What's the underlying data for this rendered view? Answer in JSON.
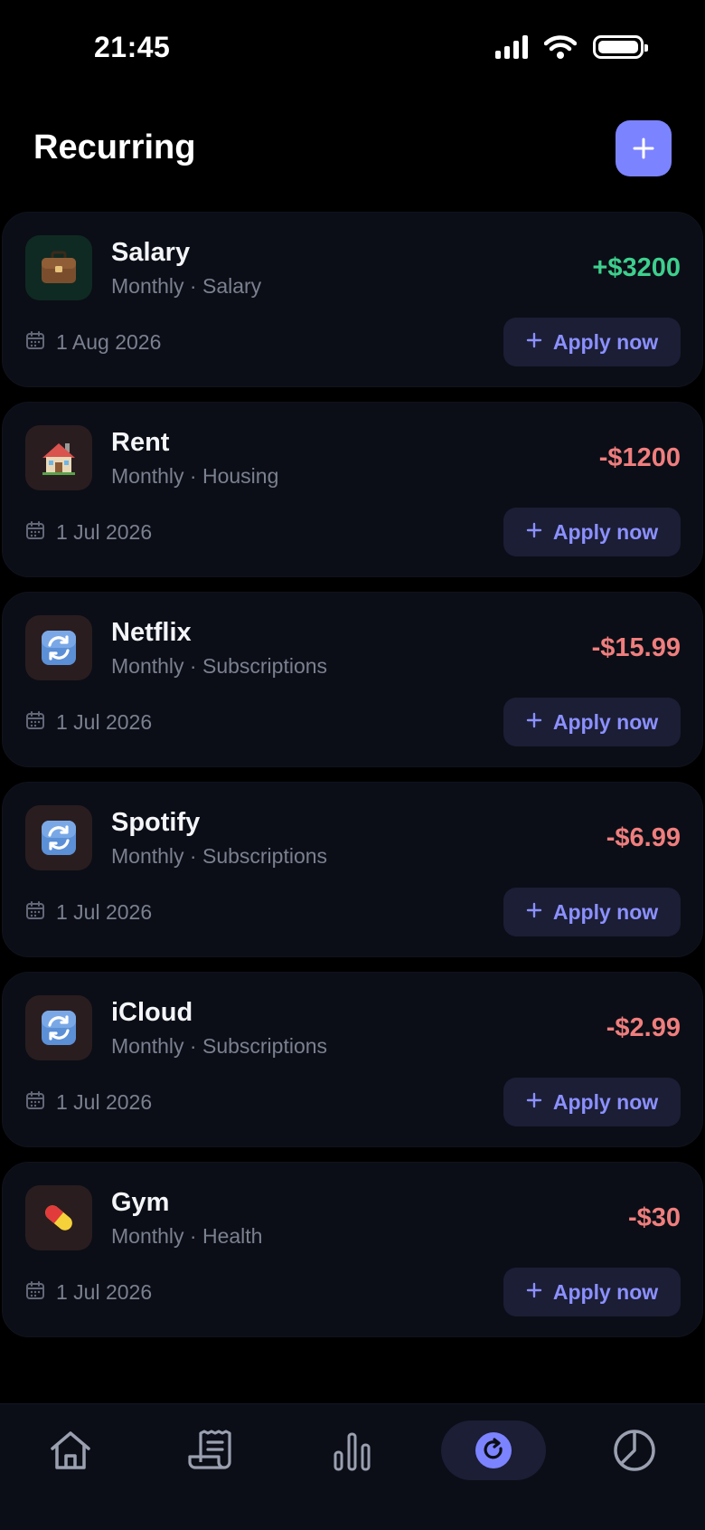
{
  "status_bar": {
    "time": "21:45"
  },
  "header": {
    "title": "Recurring",
    "add_icon": "plus-icon"
  },
  "items": [
    {
      "name": "Salary",
      "meta": "Monthly · Salary",
      "amount": "+$3200",
      "type": "income",
      "date": "1 Aug 2026",
      "icon": "briefcase-icon",
      "icon_bg": "#0f2a22",
      "apply_label": "Apply now"
    },
    {
      "name": "Rent",
      "meta": "Monthly · Housing",
      "amount": "-$1200",
      "type": "expense",
      "date": "1 Jul 2026",
      "icon": "house-icon",
      "icon_bg": "#2a1d1f",
      "apply_label": "Apply now"
    },
    {
      "name": "Netflix",
      "meta": "Monthly · Subscriptions",
      "amount": "-$15.99",
      "type": "expense",
      "date": "1 Jul 2026",
      "icon": "repeat-icon",
      "icon_bg": "#2a1d1f",
      "apply_label": "Apply now"
    },
    {
      "name": "Spotify",
      "meta": "Monthly · Subscriptions",
      "amount": "-$6.99",
      "type": "expense",
      "date": "1 Jul 2026",
      "icon": "repeat-icon",
      "icon_bg": "#2a1d1f",
      "apply_label": "Apply now"
    },
    {
      "name": "iCloud",
      "meta": "Monthly · Subscriptions",
      "amount": "-$2.99",
      "type": "expense",
      "date": "1 Jul 2026",
      "icon": "repeat-icon",
      "icon_bg": "#2a1d1f",
      "apply_label": "Apply now"
    },
    {
      "name": "Gym",
      "meta": "Monthly · Health",
      "amount": "-$30",
      "type": "expense",
      "date": "1 Jul 2026",
      "icon": "pill-icon",
      "icon_bg": "#2a1d1f",
      "apply_label": "Apply now"
    }
  ],
  "tab_bar": {
    "tabs": [
      {
        "icon": "home-icon",
        "active": false
      },
      {
        "icon": "receipt-icon",
        "active": false
      },
      {
        "icon": "bar-chart-icon",
        "active": false
      },
      {
        "icon": "recurring-icon",
        "active": true
      },
      {
        "icon": "pie-chart-icon",
        "active": false
      }
    ]
  },
  "colors": {
    "accent": "#7c83ff",
    "income": "#3ecf8e",
    "expense": "#f07e7e",
    "card": "#0b0e16",
    "background": "#000000"
  }
}
